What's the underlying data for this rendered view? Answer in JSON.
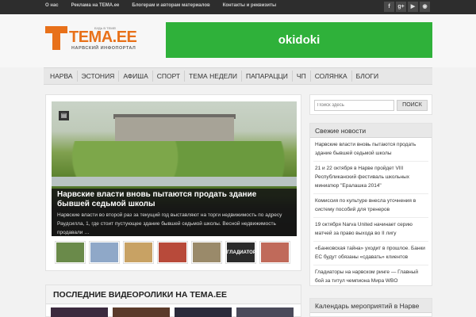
{
  "topbar": {
    "links": [
      "О нас",
      "Реклама на TEMA.ee",
      "Блогерам и авторам материалов",
      "Контакты и реквизиты"
    ],
    "social": [
      {
        "icon": "facebook-icon",
        "glyph": "f"
      },
      {
        "icon": "google-plus-icon",
        "glyph": "g+"
      },
      {
        "icon": "youtube-icon",
        "glyph": "▶"
      },
      {
        "icon": "rss-icon",
        "glyph": "◉"
      }
    ]
  },
  "header": {
    "logo_tagline": "БУДЬ В ТЕМЕ!",
    "logo_name": "ТЕМА.ЕЕ",
    "logo_sub": "НАРВСКИЙ ИНФОПОРТАЛ",
    "banner_text": "okidoki",
    "colors": {
      "brand": "#e8711a",
      "banner": "#2fb13a"
    }
  },
  "nav": {
    "items": [
      "НАРВА",
      "ЭСТОНИЯ",
      "АФИША",
      "СПОРТ",
      "ТЕМА НЕДЕЛИ",
      "ПАПАРАЦЦИ",
      "ЧП",
      "СОЛЯНКА",
      "БЛОГИ"
    ]
  },
  "feature": {
    "title": "Нарвские власти вновь пытаются продать здание бывшей седьмой школы",
    "text": "Нарвские власти во второй раз за текущий год выставляют на торги недвижимость по адресу Раудсилла, 1, где стоит пустующее здание бывшей седьмой школы. Весной недвижимость продавали …",
    "thumbs": [
      {
        "color": "#6a8a4a",
        "label": ""
      },
      {
        "color": "#8fa8c8",
        "label": ""
      },
      {
        "color": "#c8a264",
        "label": ""
      },
      {
        "color": "#b84a3a",
        "label": ""
      },
      {
        "color": "#9a8a6a",
        "label": ""
      },
      {
        "color": "#2a2a2a",
        "label": "ГЛАДИАТОРЫ"
      },
      {
        "color": "#c06a5a",
        "label": ""
      }
    ]
  },
  "videos": {
    "title": "ПОСЛЕДНИЕ ВИДЕОРОЛИКИ НА TEMA.EE"
  },
  "sidebar": {
    "search": {
      "placeholder": "Поиск здесь",
      "button": "ПОИСК"
    },
    "news_title": "Свежие новости",
    "news": [
      "Нарвские власти вновь пытаются продать здание бывшей седьмой школы",
      "21 и 22 октября в Нарве пройдет VIII Республиканский фестиваль школьных миниатюр \"Ералашка 2014\"",
      "Комиссия по культуре внесла уточнения в систему пособий для тренеров",
      "19 октября Narva United начинает серию матчей за право выхода во II лигу",
      "«Банковская тайна» уходит в прошлое. Банки ЕС будут обязаны «сдавать» клиентов",
      "Гладиаторы на нарвском ринге — Главный бой за титул чемпиона Мира WBO"
    ],
    "calendar_title": "Календарь мероприятий в Нарве"
  }
}
